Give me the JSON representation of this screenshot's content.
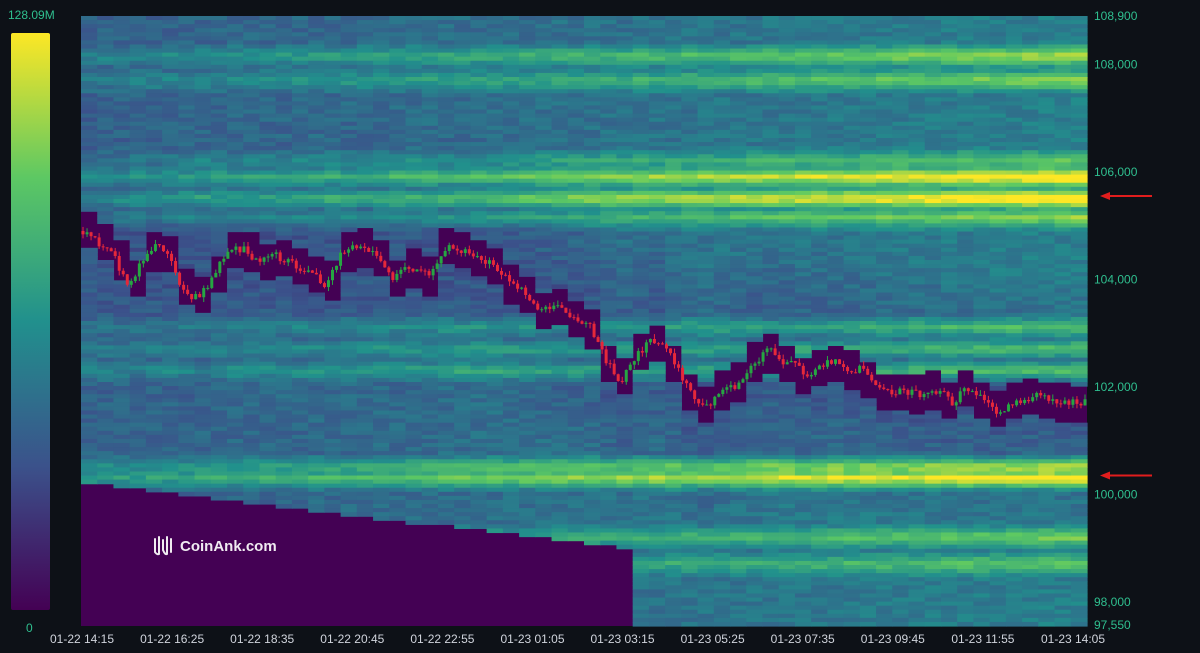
{
  "chart_data": {
    "type": "heatmap",
    "title": "",
    "colorbar": {
      "min_label": "0",
      "max_label": "128.09M",
      "colors": [
        "#440154",
        "#3b528b",
        "#21908d",
        "#5dc863",
        "#fde725"
      ]
    },
    "y_axis": {
      "range": [
        97550,
        108900
      ],
      "ticks": [
        "97,550",
        "98,000",
        "100,000",
        "102,000",
        "104,000",
        "106,000",
        "108,000",
        "108,900"
      ],
      "tick_values": [
        97550,
        98000,
        100000,
        102000,
        104000,
        106000,
        108000,
        108900
      ]
    },
    "x_axis": {
      "ticks": [
        "01-22 14:15",
        "01-22 16:25",
        "01-22 18:35",
        "01-22 20:45",
        "01-22 22:55",
        "01-23 01:05",
        "01-23 03:15",
        "01-23 05:25",
        "01-23 07:35",
        "01-23 09:45",
        "01-23 11:55",
        "01-23 14:05"
      ]
    },
    "price_path": [
      [
        0,
        104900
      ],
      [
        4,
        104500
      ],
      [
        6,
        103900
      ],
      [
        8,
        104300
      ],
      [
        10,
        104750
      ],
      [
        12,
        104300
      ],
      [
        14,
        103700
      ],
      [
        16,
        103700
      ],
      [
        18,
        104150
      ],
      [
        20,
        104550
      ],
      [
        22,
        104550
      ],
      [
        24,
        104300
      ],
      [
        26,
        104450
      ],
      [
        28,
        104300
      ],
      [
        31,
        104150
      ],
      [
        33,
        103850
      ],
      [
        35,
        104450
      ],
      [
        37,
        104650
      ],
      [
        40,
        104450
      ],
      [
        42,
        103950
      ],
      [
        44,
        104250
      ],
      [
        47,
        104050
      ],
      [
        49,
        104600
      ],
      [
        51,
        104550
      ],
      [
        54,
        104350
      ],
      [
        56,
        104250
      ],
      [
        58,
        103900
      ],
      [
        60,
        103750
      ],
      [
        62,
        103400
      ],
      [
        65,
        103500
      ],
      [
        67,
        103250
      ],
      [
        69,
        103100
      ],
      [
        71,
        102500
      ],
      [
        73,
        102100
      ],
      [
        75,
        102550
      ],
      [
        77,
        102850
      ],
      [
        79,
        102800
      ],
      [
        81,
        102250
      ],
      [
        83,
        101750
      ],
      [
        85,
        101650
      ],
      [
        87,
        101950
      ],
      [
        89,
        102050
      ],
      [
        91,
        102400
      ],
      [
        93,
        102700
      ],
      [
        95,
        102450
      ],
      [
        97,
        102450
      ],
      [
        98,
        102200
      ],
      [
        100,
        102350
      ],
      [
        102,
        102500
      ],
      [
        104,
        102300
      ],
      [
        106,
        102350
      ],
      [
        108,
        101950
      ],
      [
        110,
        101900
      ],
      [
        112,
        101900
      ],
      [
        114,
        101850
      ],
      [
        116,
        101950
      ],
      [
        118,
        101700
      ],
      [
        120,
        102000
      ],
      [
        122,
        101850
      ],
      [
        124,
        101500
      ],
      [
        126,
        101700
      ],
      [
        128,
        101750
      ],
      [
        130,
        101850
      ],
      [
        132,
        101750
      ],
      [
        134,
        101700
      ],
      [
        136,
        101700
      ]
    ],
    "liquidity_bands": [
      {
        "price": 108150,
        "intensity": 0.62
      },
      {
        "price": 107700,
        "intensity": 0.55
      },
      {
        "price": 106200,
        "intensity": 0.45
      },
      {
        "price": 105900,
        "intensity": 0.92
      },
      {
        "price": 105500,
        "intensity": 0.98
      },
      {
        "price": 105150,
        "intensity": 0.55
      },
      {
        "price": 103100,
        "intensity": 0.5
      },
      {
        "price": 102700,
        "intensity": 0.55
      },
      {
        "price": 102300,
        "intensity": 0.6
      },
      {
        "price": 100500,
        "intensity": 0.8
      },
      {
        "price": 100300,
        "intensity": 1.0
      },
      {
        "price": 99200,
        "intensity": 0.5
      },
      {
        "price": 98700,
        "intensity": 0.45
      }
    ],
    "markers": [
      {
        "price": 105550,
        "color": "#e11d1d"
      },
      {
        "price": 100350,
        "color": "#e11d1d"
      }
    ]
  },
  "watermark": {
    "text": "CoinAnk.com",
    "icon": "coinank-logo-icon"
  }
}
